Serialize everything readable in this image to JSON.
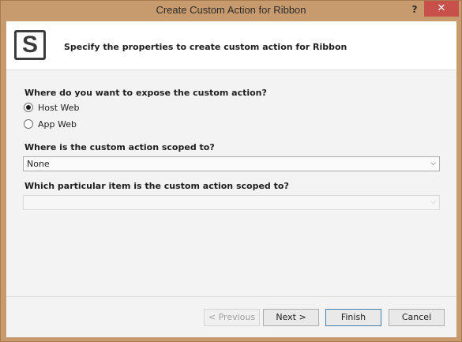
{
  "window": {
    "title": "Create Custom Action for Ribbon",
    "help_label": "?",
    "close_label": "✕"
  },
  "header": {
    "logo_letter": "S",
    "description": "Specify the properties to create custom action for Ribbon"
  },
  "expose": {
    "question": "Where do you want to expose the custom action?",
    "options": [
      {
        "label": "Host Web",
        "checked": true
      },
      {
        "label": "App Web",
        "checked": false
      }
    ]
  },
  "scope": {
    "question": "Where is the custom action scoped to?",
    "selected": "None"
  },
  "item_scope": {
    "question": "Which particular item is the custom action scoped to?",
    "selected": "",
    "enabled": false
  },
  "buttons": {
    "previous": "< Previous",
    "next": "Next >",
    "finish": "Finish",
    "cancel": "Cancel"
  },
  "icons": {
    "dropdown": "chevron-down-icon",
    "logo": "sharepoint-logo-icon"
  }
}
